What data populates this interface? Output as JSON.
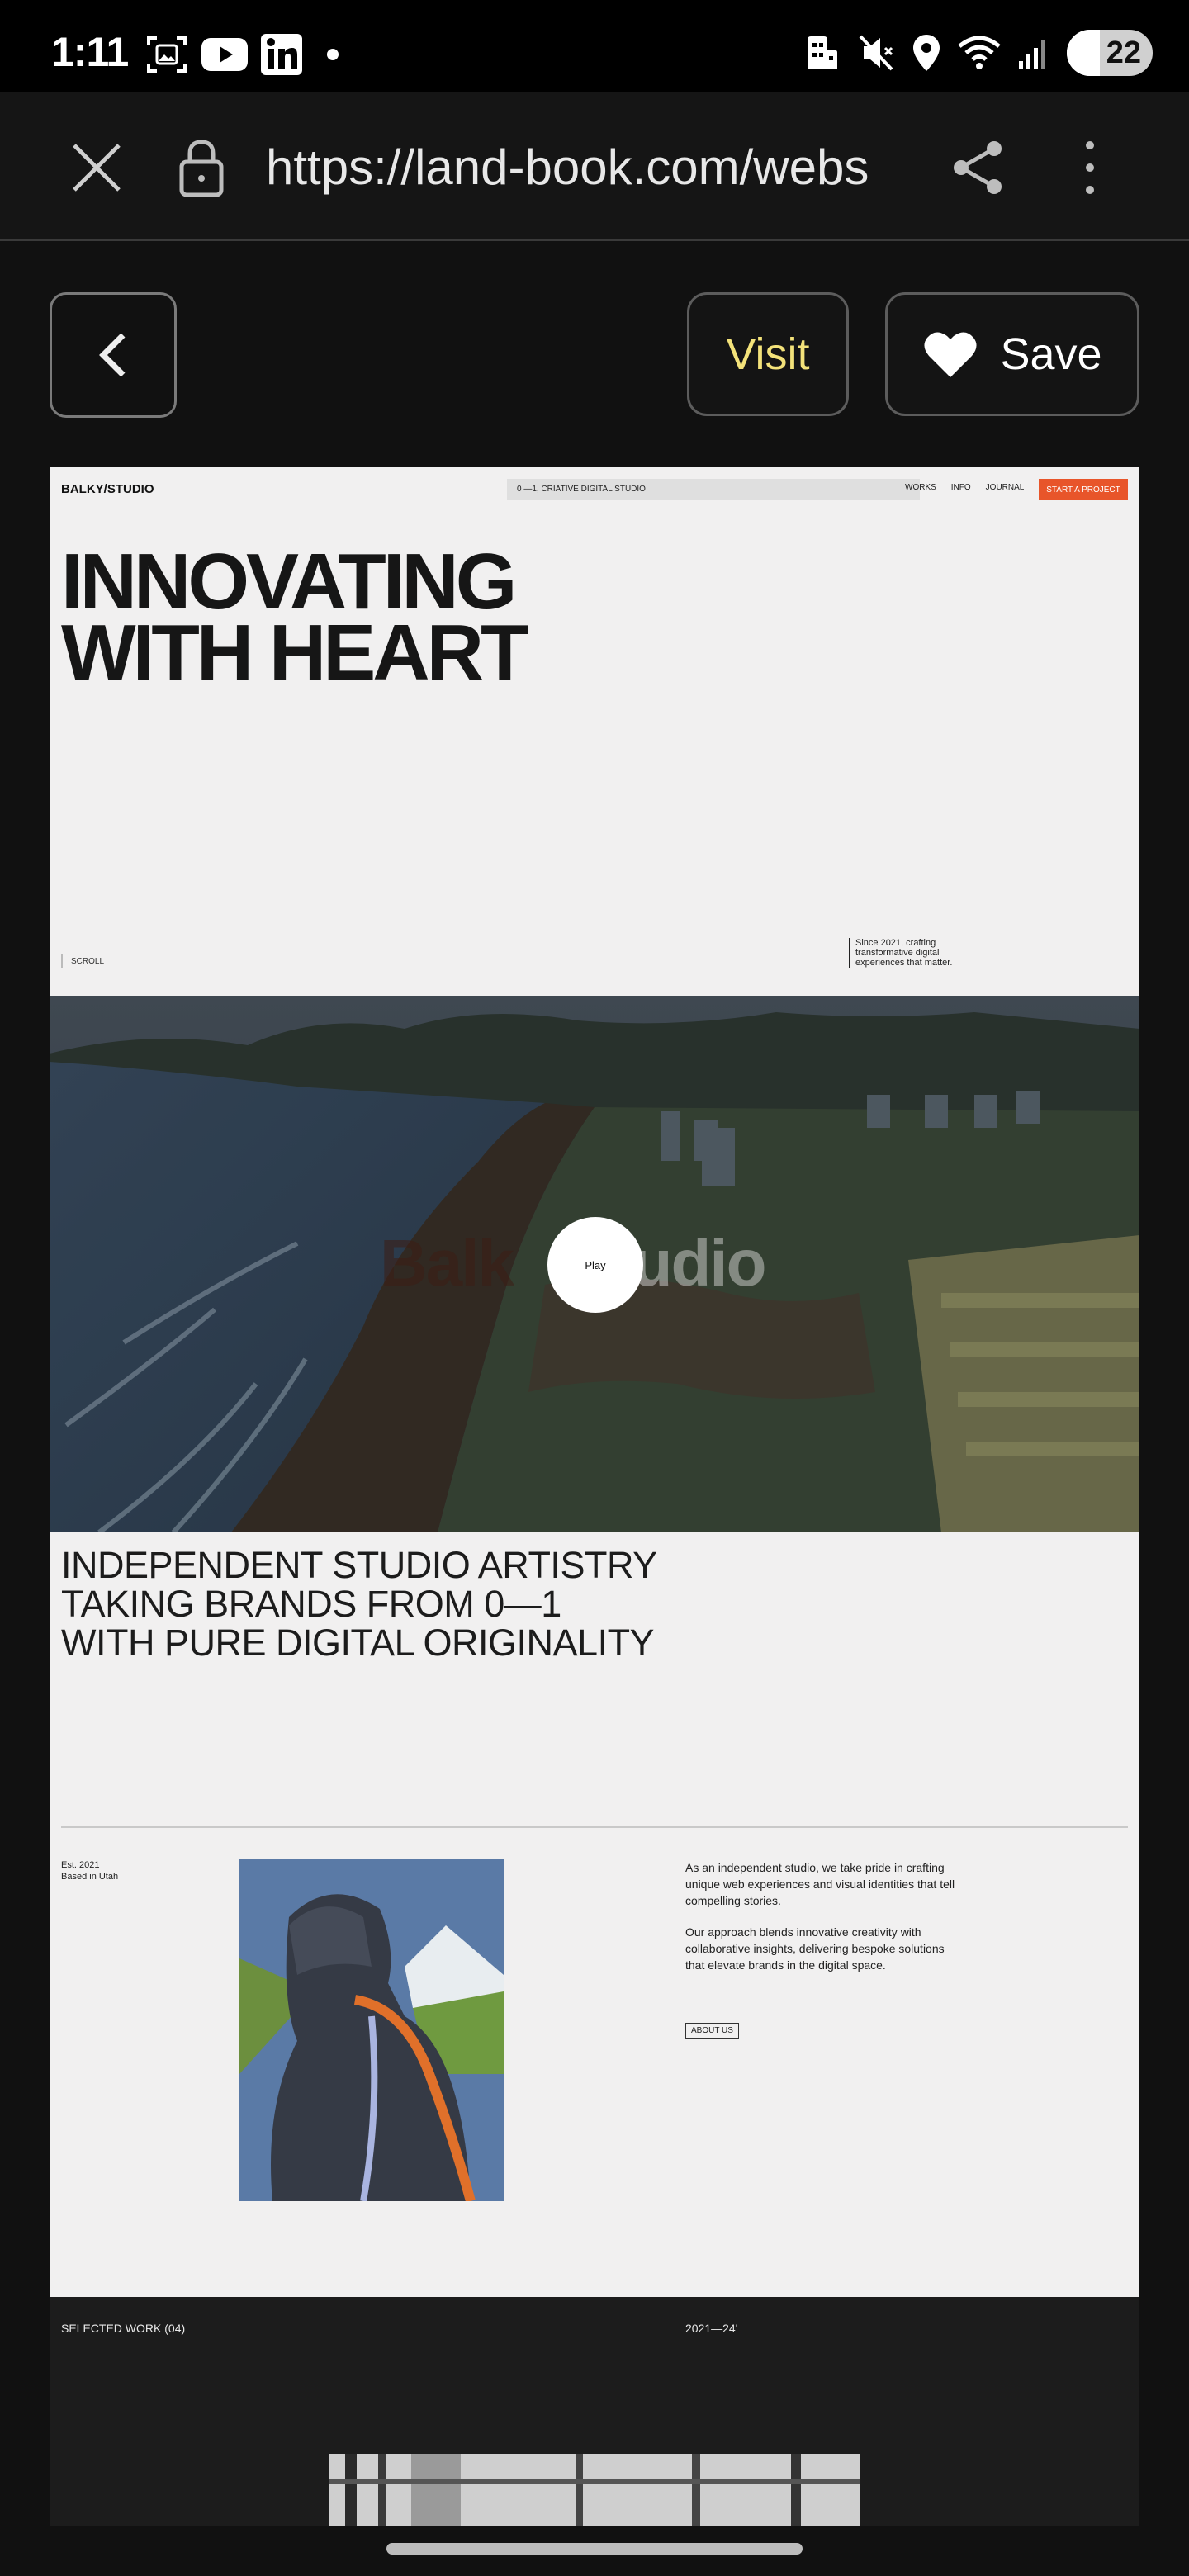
{
  "status_bar": {
    "time": "1:11",
    "battery_level": "22"
  },
  "browser": {
    "url": "https://land-book.com/webs"
  },
  "header": {
    "visit_label": "Visit",
    "save_label": "Save",
    "accent_color": "#f3e27a"
  },
  "site": {
    "logo": "BALKY/STUDIO",
    "tagline": "0 —1, CRIATIVE DIGITAL STUDIO",
    "nav": [
      "WORKS",
      "INFO",
      "JOURNAL"
    ],
    "cta": "START A PROJECT",
    "cta_color": "#e8552a",
    "hero_lines": [
      "INNOVATING",
      "WITH HEART"
    ],
    "scroll_label": "SCROLL",
    "since_text": "Since 2021, crafting transformative digital experiences that matter.",
    "video": {
      "logo_part1": "Balk",
      "logo_part2": "tudio",
      "play_label": "Play"
    },
    "mission_lines": [
      "INDEPENDENT STUDIO ARTISTRY",
      "TAKING BRANDS FROM 0—1",
      "WITH PURE DIGITAL ORIGINALITY"
    ],
    "est_lines": [
      "Est. 2021",
      "Based in Utah"
    ],
    "about_paragraphs": [
      "As an independent studio, we take pride in crafting unique web experiences and visual identities that tell compelling stories.",
      "Our approach blends innovative creativity with collaborative insights, delivering bespoke solutions that elevate brands in the digital space."
    ],
    "about_button": "ABOUT US",
    "work_label": "SELECTED WORK (04)",
    "work_range": "2021—24'"
  }
}
